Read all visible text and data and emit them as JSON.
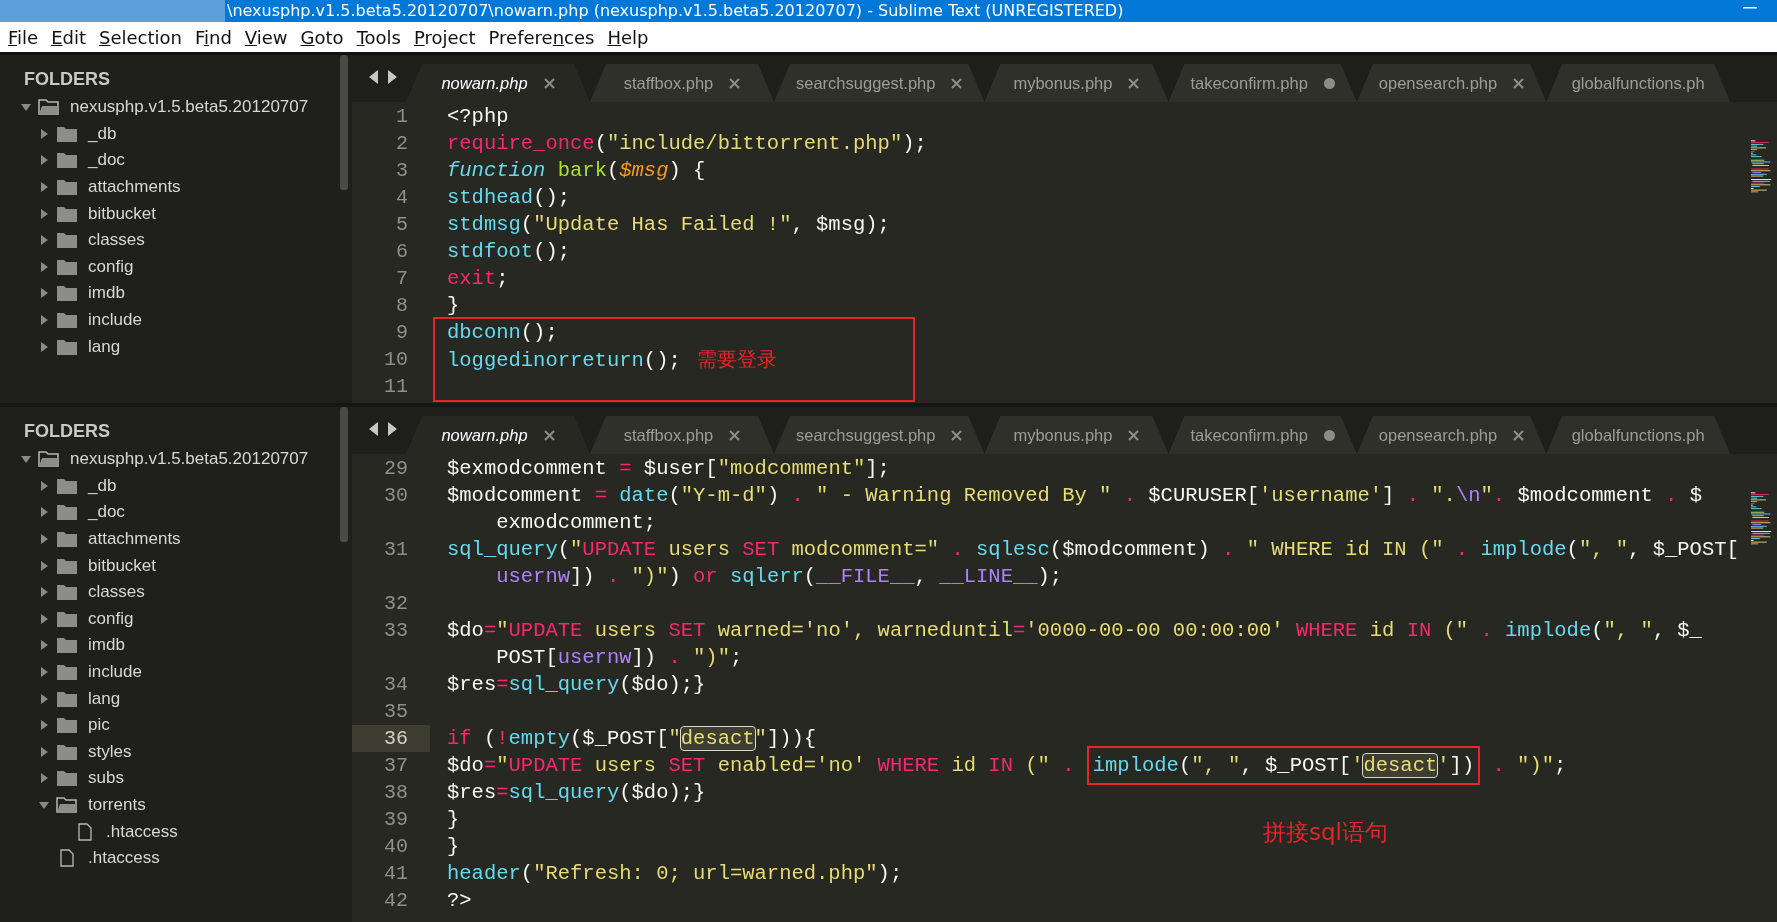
{
  "window": {
    "title": "\\nexusphp.v1.5.beta5.20120707\\nowarn.php (nexusphp.v1.5.beta5.20120707) - Sublime Text (UNREGISTERED)"
  },
  "menu": [
    {
      "key": "F",
      "rest": "ile"
    },
    {
      "key": "E",
      "rest": "dit"
    },
    {
      "key": "S",
      "rest": "election"
    },
    {
      "lead": "F",
      "key": "i",
      "rest": "nd"
    },
    {
      "key": "V",
      "rest": "iew"
    },
    {
      "key": "G",
      "rest": "oto"
    },
    {
      "key": "T",
      "rest": "ools"
    },
    {
      "key": "P",
      "rest": "roject"
    },
    {
      "lead": "Prefere",
      "key": "n",
      "rest": "ces"
    },
    {
      "key": "H",
      "rest": "elp"
    }
  ],
  "panes": [
    {
      "sidebar": {
        "heading": "FOLDERS",
        "tree": [
          {
            "label": "nexusphp.v1.5.beta5.20120707",
            "kind": "folder",
            "expanded": true,
            "children": [
              {
                "label": "_db",
                "kind": "folder",
                "expanded": false
              },
              {
                "label": "_doc",
                "kind": "folder",
                "expanded": false
              },
              {
                "label": "attachments",
                "kind": "folder",
                "expanded": false
              },
              {
                "label": "bitbucket",
                "kind": "folder",
                "expanded": false
              },
              {
                "label": "classes",
                "kind": "folder",
                "expanded": false
              },
              {
                "label": "config",
                "kind": "folder",
                "expanded": false
              },
              {
                "label": "imdb",
                "kind": "folder",
                "expanded": false
              },
              {
                "label": "include",
                "kind": "folder",
                "expanded": false
              },
              {
                "label": "lang",
                "kind": "folder",
                "expanded": false
              }
            ]
          }
        ]
      },
      "tabs": [
        {
          "label": "nowarn.php",
          "selected": true,
          "modified": false
        },
        {
          "label": "staffbox.php",
          "selected": false,
          "modified": false
        },
        {
          "label": "searchsuggest.php",
          "selected": false,
          "modified": false
        },
        {
          "label": "mybonus.php",
          "selected": false,
          "modified": false
        },
        {
          "label": "takeconfirm.php",
          "selected": false,
          "modified": true
        },
        {
          "label": "opensearch.php",
          "selected": false,
          "modified": false
        },
        {
          "label": "globalfunctions.ph",
          "selected": false
        }
      ],
      "blocks": [
        {
          "kind": "line",
          "number": "1",
          "current": false,
          "tokens": [
            {
              "kind": "plain",
              "text": "<?php"
            }
          ]
        },
        {
          "kind": "line",
          "number": "2",
          "current": false,
          "tokens": [
            {
              "kind": "keyword",
              "text": "require_once"
            },
            {
              "kind": "plain",
              "text": "("
            },
            {
              "kind": "string",
              "text": "\"include/bittorrent.php\""
            },
            {
              "kind": "plain",
              "text": ");"
            }
          ]
        },
        {
          "kind": "line",
          "number": "3",
          "current": false,
          "tokens": [
            {
              "kind": "storage",
              "text": "function"
            },
            {
              "kind": "entity",
              "text": " bark"
            },
            {
              "kind": "plain",
              "text": "("
            },
            {
              "kind": "param",
              "text": "$msg"
            },
            {
              "kind": "plain",
              "text": ") {"
            }
          ]
        },
        {
          "kind": "line",
          "number": "4",
          "current": false,
          "tokens": [
            {
              "kind": "func",
              "text": "stdhead"
            },
            {
              "kind": "plain",
              "text": "();"
            }
          ]
        },
        {
          "kind": "line",
          "number": "5",
          "current": false,
          "tokens": [
            {
              "kind": "func",
              "text": "stdmsg"
            },
            {
              "kind": "plain",
              "text": "("
            },
            {
              "kind": "string",
              "text": "\"Update Has Failed !\""
            },
            {
              "kind": "plain",
              "text": ", $msg);"
            }
          ]
        },
        {
          "kind": "line",
          "number": "6",
          "current": false,
          "tokens": [
            {
              "kind": "func",
              "text": "stdfoot"
            },
            {
              "kind": "plain",
              "text": "();"
            }
          ]
        },
        {
          "kind": "line",
          "number": "7",
          "current": false,
          "tokens": [
            {
              "kind": "keyword",
              "text": "exit"
            },
            {
              "kind": "plain",
              "text": ";"
            }
          ]
        },
        {
          "kind": "line",
          "number": "8",
          "current": false,
          "tokens": [
            {
              "kind": "plain",
              "text": "}"
            }
          ]
        },
        {
          "kind": "boxed",
          "lines": [
            {
              "number": "9",
              "current": false,
              "tokens": [
                {
                  "kind": "func",
                  "text": "dbconn"
                },
                {
                  "kind": "plain",
                  "text": "();"
                }
              ]
            },
            {
              "number": "10",
              "current": false,
              "tokens": [
                {
                  "kind": "func",
                  "text": "loggedinorreturn"
                },
                {
                  "kind": "plain",
                  "text": "(); "
                },
                {
                  "kind": "note",
                  "text": "需要登录"
                }
              ]
            },
            {
              "number": "11",
              "current": false
            }
          ]
        }
      ]
    },
    {
      "sidebar": {
        "heading": "FOLDERS",
        "tree": [
          {
            "label": "nexusphp.v1.5.beta5.20120707",
            "kind": "folder",
            "expanded": true,
            "children": [
              {
                "label": "_db",
                "kind": "folder",
                "expanded": false
              },
              {
                "label": "_doc",
                "kind": "folder",
                "expanded": false
              },
              {
                "label": "attachments",
                "kind": "folder",
                "expanded": false
              },
              {
                "label": "bitbucket",
                "kind": "folder",
                "expanded": false
              },
              {
                "label": "classes",
                "kind": "folder",
                "expanded": false
              },
              {
                "label": "config",
                "kind": "folder",
                "expanded": false
              },
              {
                "label": "imdb",
                "kind": "folder",
                "expanded": false
              },
              {
                "label": "include",
                "kind": "folder",
                "expanded": false
              },
              {
                "label": "lang",
                "kind": "folder",
                "expanded": false
              },
              {
                "label": "pic",
                "kind": "folder",
                "expanded": false
              },
              {
                "label": "styles",
                "kind": "folder",
                "expanded": false
              },
              {
                "label": "subs",
                "kind": "folder",
                "expanded": false
              },
              {
                "label": "torrents",
                "kind": "folder",
                "expanded": true,
                "children": [
                  {
                    "label": ".htaccess",
                    "kind": "file"
                  }
                ]
              },
              {
                "label": ".htaccess",
                "kind": "file"
              }
            ]
          }
        ]
      },
      "tabs": [
        {
          "label": "nowarn.php",
          "selected": true,
          "modified": false
        },
        {
          "label": "staffbox.php",
          "selected": false,
          "modified": false
        },
        {
          "label": "searchsuggest.php",
          "selected": false,
          "modified": false
        },
        {
          "label": "mybonus.php",
          "selected": false,
          "modified": false
        },
        {
          "label": "takeconfirm.php",
          "selected": false,
          "modified": true
        },
        {
          "label": "opensearch.php",
          "selected": false,
          "modified": false
        },
        {
          "label": "globalfunctions.ph",
          "selected": false
        }
      ],
      "annotation": "拼接sql语句",
      "blocks": [
        {
          "kind": "line",
          "number": "29",
          "current": false,
          "tokens": [
            {
              "kind": "plain",
              "text": "$exmodcomment "
            },
            {
              "kind": "keyword",
              "text": "="
            },
            {
              "kind": "plain",
              "text": " $user["
            },
            {
              "kind": "string",
              "text": "\"modcomment\""
            },
            {
              "kind": "plain",
              "text": "];"
            }
          ]
        },
        {
          "kind": "line",
          "number": "30",
          "current": false,
          "tokens": [
            {
              "kind": "plain",
              "text": "$modcomment "
            },
            {
              "kind": "keyword",
              "text": "="
            },
            {
              "kind": "func",
              "text": " date"
            },
            {
              "kind": "plain",
              "text": "("
            },
            {
              "kind": "string",
              "text": "\"Y-m-d\""
            },
            {
              "kind": "plain",
              "text": ") "
            },
            {
              "kind": "keyword",
              "text": "."
            },
            {
              "kind": "string",
              "text": " \" - Warning Removed By \""
            },
            {
              "kind": "keyword",
              "text": " ."
            },
            {
              "kind": "plain",
              "text": " $CURUSER["
            },
            {
              "kind": "string",
              "text": "'username'"
            },
            {
              "kind": "plain",
              "text": "] "
            },
            {
              "kind": "keyword",
              "text": "."
            },
            {
              "kind": "string",
              "text": " \"."
            },
            {
              "kind": "constant",
              "text": "\\n"
            },
            {
              "kind": "string",
              "text": "\""
            },
            {
              "kind": "keyword",
              "text": "."
            },
            {
              "kind": "plain",
              "text": " $modcomment "
            },
            {
              "kind": "keyword",
              "text": "."
            },
            {
              "kind": "plain",
              "text": " $"
            }
          ],
          "wrap": [
            {
              "kind": "plain",
              "text": "exmodcomment;"
            }
          ]
        },
        {
          "kind": "line",
          "number": "31",
          "current": false,
          "tokens": [
            {
              "kind": "func",
              "text": "sql_query"
            },
            {
              "kind": "plain",
              "text": "("
            },
            {
              "kind": "string",
              "text": "\""
            },
            {
              "kind": "keyword",
              "text": "UPDATE"
            },
            {
              "kind": "string",
              "text": " users "
            },
            {
              "kind": "keyword",
              "text": "SET"
            },
            {
              "kind": "string",
              "text": " modcomment=\""
            },
            {
              "kind": "keyword",
              "text": " ."
            },
            {
              "kind": "func",
              "text": " sqlesc"
            },
            {
              "kind": "plain",
              "text": "($modcomment) "
            },
            {
              "kind": "keyword",
              "text": "."
            },
            {
              "kind": "string",
              "text": " \" WHERE id IN (\""
            },
            {
              "kind": "keyword",
              "text": " ."
            },
            {
              "kind": "func",
              "text": " implode"
            },
            {
              "kind": "plain",
              "text": "("
            },
            {
              "kind": "string",
              "text": "\", \""
            },
            {
              "kind": "plain",
              "text": ", $_POST["
            }
          ],
          "wrap": [
            {
              "kind": "constant",
              "text": "usernw"
            },
            {
              "kind": "plain",
              "text": "]) "
            },
            {
              "kind": "keyword",
              "text": "."
            },
            {
              "kind": "string",
              "text": " \")\""
            },
            {
              "kind": "plain",
              "text": ") "
            },
            {
              "kind": "keyword",
              "text": "or"
            },
            {
              "kind": "func",
              "text": " sqlerr"
            },
            {
              "kind": "plain",
              "text": "("
            },
            {
              "kind": "constant",
              "text": "__FILE__"
            },
            {
              "kind": "plain",
              "text": ", "
            },
            {
              "kind": "constant",
              "text": "__LINE__"
            },
            {
              "kind": "plain",
              "text": ");"
            }
          ]
        },
        {
          "kind": "line",
          "number": "32",
          "current": false
        },
        {
          "kind": "line",
          "number": "33",
          "current": false,
          "tokens": [
            {
              "kind": "plain",
              "text": "$do"
            },
            {
              "kind": "keyword",
              "text": "="
            },
            {
              "kind": "string",
              "text": "\""
            },
            {
              "kind": "keyword",
              "text": "UPDATE"
            },
            {
              "kind": "string",
              "text": " users "
            },
            {
              "kind": "keyword",
              "text": "SET"
            },
            {
              "kind": "string",
              "text": " warned='no', warneduntil"
            },
            {
              "kind": "keyword",
              "text": "="
            },
            {
              "kind": "string",
              "text": "'0000-00-00 00:00:00' "
            },
            {
              "kind": "keyword",
              "text": "WHERE"
            },
            {
              "kind": "string",
              "text": " id "
            },
            {
              "kind": "keyword",
              "text": "IN"
            },
            {
              "kind": "string",
              "text": " (\""
            },
            {
              "kind": "keyword",
              "text": " ."
            },
            {
              "kind": "func",
              "text": " implode"
            },
            {
              "kind": "plain",
              "text": "("
            },
            {
              "kind": "string",
              "text": "\", \""
            },
            {
              "kind": "plain",
              "text": ", $_"
            }
          ],
          "wrap": [
            {
              "kind": "plain",
              "text": "POST["
            },
            {
              "kind": "constant",
              "text": "usernw"
            },
            {
              "kind": "plain",
              "text": "]) "
            },
            {
              "kind": "keyword",
              "text": "."
            },
            {
              "kind": "string",
              "text": " \")\""
            },
            {
              "kind": "plain",
              "text": ";"
            }
          ]
        },
        {
          "kind": "line",
          "number": "34",
          "current": false,
          "tokens": [
            {
              "kind": "plain",
              "text": "$res"
            },
            {
              "kind": "keyword",
              "text": "="
            },
            {
              "kind": "func",
              "text": "sql_query"
            },
            {
              "kind": "plain",
              "text": "($do);}"
            }
          ]
        },
        {
          "kind": "line",
          "number": "35",
          "current": false
        },
        {
          "kind": "line",
          "number": "36",
          "current": true,
          "tokens": [
            {
              "kind": "keyword",
              "text": "if"
            },
            {
              "kind": "plain",
              "text": " ("
            },
            {
              "kind": "keyword",
              "text": "!"
            },
            {
              "kind": "func",
              "text": "empty"
            },
            {
              "kind": "plain",
              "text": "($_POST["
            },
            {
              "kind": "string",
              "text": "\""
            },
            {
              "kind": "match",
              "text": "desact"
            },
            {
              "kind": "string",
              "text": "\""
            },
            {
              "kind": "plain",
              "text": "])){"
            }
          ]
        },
        {
          "kind": "line",
          "number": "37",
          "current": false,
          "tokens": [
            {
              "kind": "plain",
              "text": "$do"
            },
            {
              "kind": "keyword",
              "text": "="
            },
            {
              "kind": "string",
              "text": "\""
            },
            {
              "kind": "keyword",
              "text": "UPDATE"
            },
            {
              "kind": "string",
              "text": " users "
            },
            {
              "kind": "keyword",
              "text": "SET"
            },
            {
              "kind": "string",
              "text": " enabled='no' "
            },
            {
              "kind": "keyword",
              "text": "WHERE"
            },
            {
              "kind": "string",
              "text": " id "
            },
            {
              "kind": "keyword",
              "text": "IN"
            },
            {
              "kind": "string",
              "text": " (\""
            },
            {
              "kind": "keyword",
              "text": " . "
            },
            {
              "kind": "boxed",
              "tokens": [
                {
                  "kind": "func",
                  "text": "implode"
                },
                {
                  "kind": "plain",
                  "text": "("
                },
                {
                  "kind": "string",
                  "text": "\", \""
                },
                {
                  "kind": "plain",
                  "text": ", $_POST["
                },
                {
                  "kind": "string",
                  "text": "'"
                },
                {
                  "kind": "match",
                  "text": "desact"
                },
                {
                  "kind": "string",
                  "text": "'"
                },
                {
                  "kind": "plain",
                  "text": "])"
                }
              ]
            },
            {
              "kind": "keyword",
              "text": " ."
            },
            {
              "kind": "string",
              "text": " \")\""
            },
            {
              "kind": "plain",
              "text": ";"
            }
          ]
        },
        {
          "kind": "line",
          "number": "38",
          "current": false,
          "tokens": [
            {
              "kind": "plain",
              "text": "$res"
            },
            {
              "kind": "keyword",
              "text": "="
            },
            {
              "kind": "func",
              "text": "sql_query"
            },
            {
              "kind": "plain",
              "text": "($do);}"
            }
          ]
        },
        {
          "kind": "line",
          "number": "39",
          "current": false,
          "tokens": [
            {
              "kind": "plain",
              "text": "}"
            }
          ]
        },
        {
          "kind": "line",
          "number": "40",
          "current": false,
          "tokens": [
            {
              "kind": "plain",
              "text": "}"
            }
          ]
        },
        {
          "kind": "line",
          "number": "41",
          "current": false,
          "tokens": [
            {
              "kind": "func",
              "text": "header"
            },
            {
              "kind": "plain",
              "text": "("
            },
            {
              "kind": "string",
              "text": "\"Refresh: 0; url=warned.php\""
            },
            {
              "kind": "plain",
              "text": ");"
            }
          ]
        },
        {
          "kind": "line",
          "number": "42",
          "current": false,
          "tokens": [
            {
              "kind": "plain",
              "text": "?>"
            }
          ]
        }
      ]
    }
  ]
}
